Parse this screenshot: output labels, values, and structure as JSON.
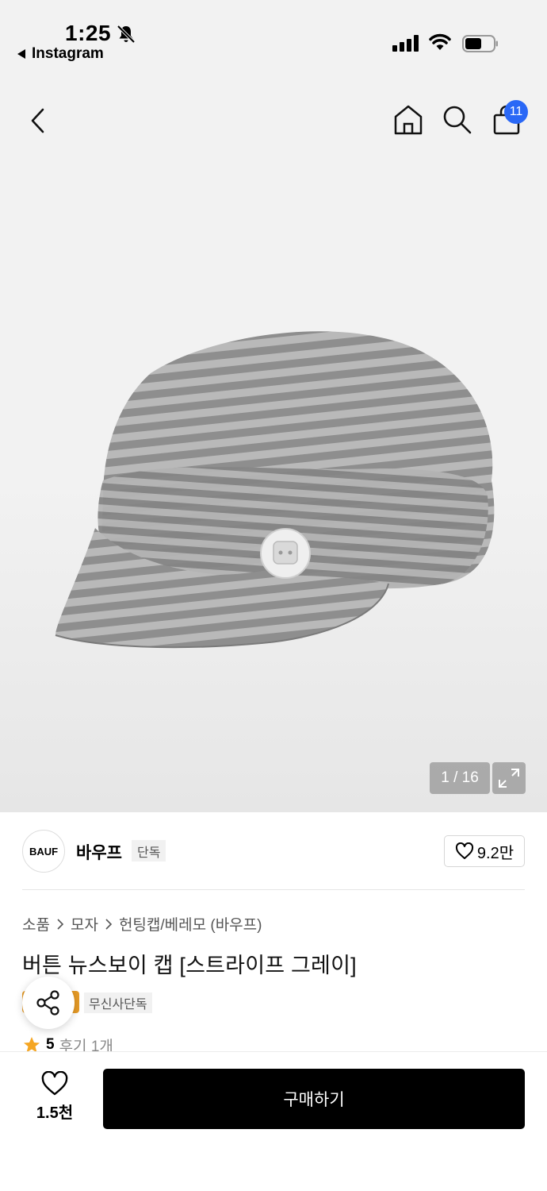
{
  "status_bar": {
    "time": "1:25",
    "back_app": "Instagram",
    "icons": [
      "bell-slash-icon",
      "cellular-signal-icon",
      "wifi-icon",
      "battery-icon"
    ]
  },
  "nav": {
    "icons": [
      "back-arrow-icon",
      "home-icon",
      "search-icon",
      "shopping-bag-icon"
    ],
    "cart_count": "11"
  },
  "gallery": {
    "pager": "1 / 16",
    "product_image": "striped gray newsboy cap with white button"
  },
  "brand": {
    "logo_text": "BAUF",
    "name": "바우프",
    "tag": "단독",
    "likes": "9.2만"
  },
  "breadcrumb": [
    "소품",
    "모자",
    "헌팅캡/베레모 (바우프)"
  ],
  "product": {
    "title": "버튼 뉴스보이 캡 [스트라이프 그레이]",
    "tag": "무신사단독",
    "rating": "5",
    "reviews": "후기 1개"
  },
  "bottom_bar": {
    "wish_count": "1.5천",
    "buy_label": "구매하기"
  },
  "colors": {
    "accent_blue": "#2a68f6",
    "star": "#f5a623",
    "badge_orange": "#e59a26",
    "buy_button": "#000000"
  }
}
